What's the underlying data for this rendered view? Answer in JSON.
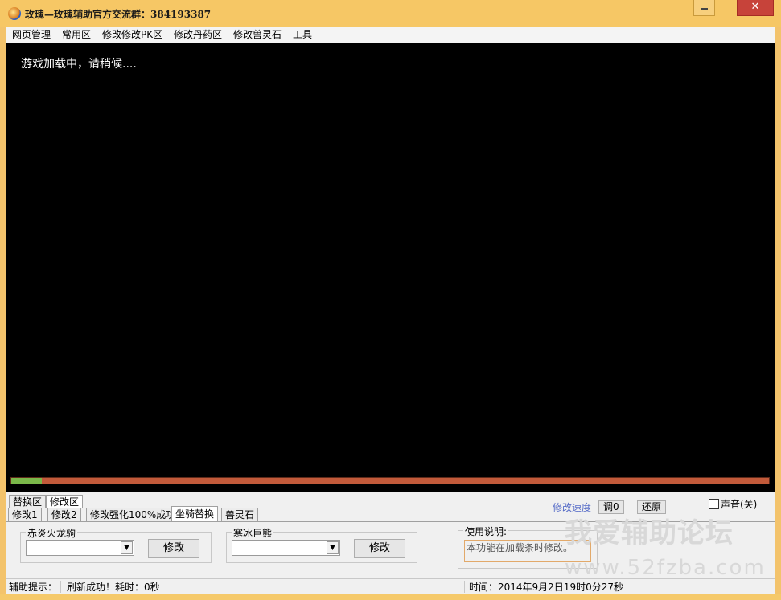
{
  "window": {
    "title": "玫瑰—玫瑰辅助官方交流群：384193387",
    "close_glyph": "✕"
  },
  "menu": {
    "items": [
      "网页管理",
      "常用区",
      "修改修改PK区",
      "修改丹药区",
      "修改兽灵石",
      "工具"
    ]
  },
  "viewport": {
    "loading_text": "游戏加载中，请稍候....",
    "progress_fraction": 0.04,
    "progress_color": "#7bb84a",
    "track_color": "#c25a3a"
  },
  "panel": {
    "top_tabs": [
      "替换区",
      "修改区"
    ],
    "top_tab_active": "修改区",
    "sub_tabs": [
      "修改1",
      "修改2",
      "修改强化100%成功",
      "坐骑替换",
      "兽灵石"
    ],
    "sub_tab_active": "坐骑替换",
    "speed_label": "修改速度",
    "speed_adjust_btn": "调0",
    "restore_btn": "还原",
    "sound_label": "声音(关)",
    "group1": {
      "legend": "赤炎火龙驹",
      "select_value": "",
      "button": "修改"
    },
    "group2": {
      "legend": "寒冰巨熊",
      "select_value": "",
      "button": "修改"
    },
    "usage": {
      "legend": "使用说明:",
      "text": "本功能在加载条时修改。"
    }
  },
  "watermark": {
    "line1": "我爱辅助论坛",
    "line2": "www.52fzba.com"
  },
  "status": {
    "hint_label": "辅助提示：",
    "message": "刷新成功！耗时：0秒",
    "time": "时间：2014年9月2日19时0分27秒"
  },
  "colors": {
    "title_bg": "#f6c765",
    "close_bg": "#c7433a",
    "speed_label": "#5a6fc8"
  }
}
